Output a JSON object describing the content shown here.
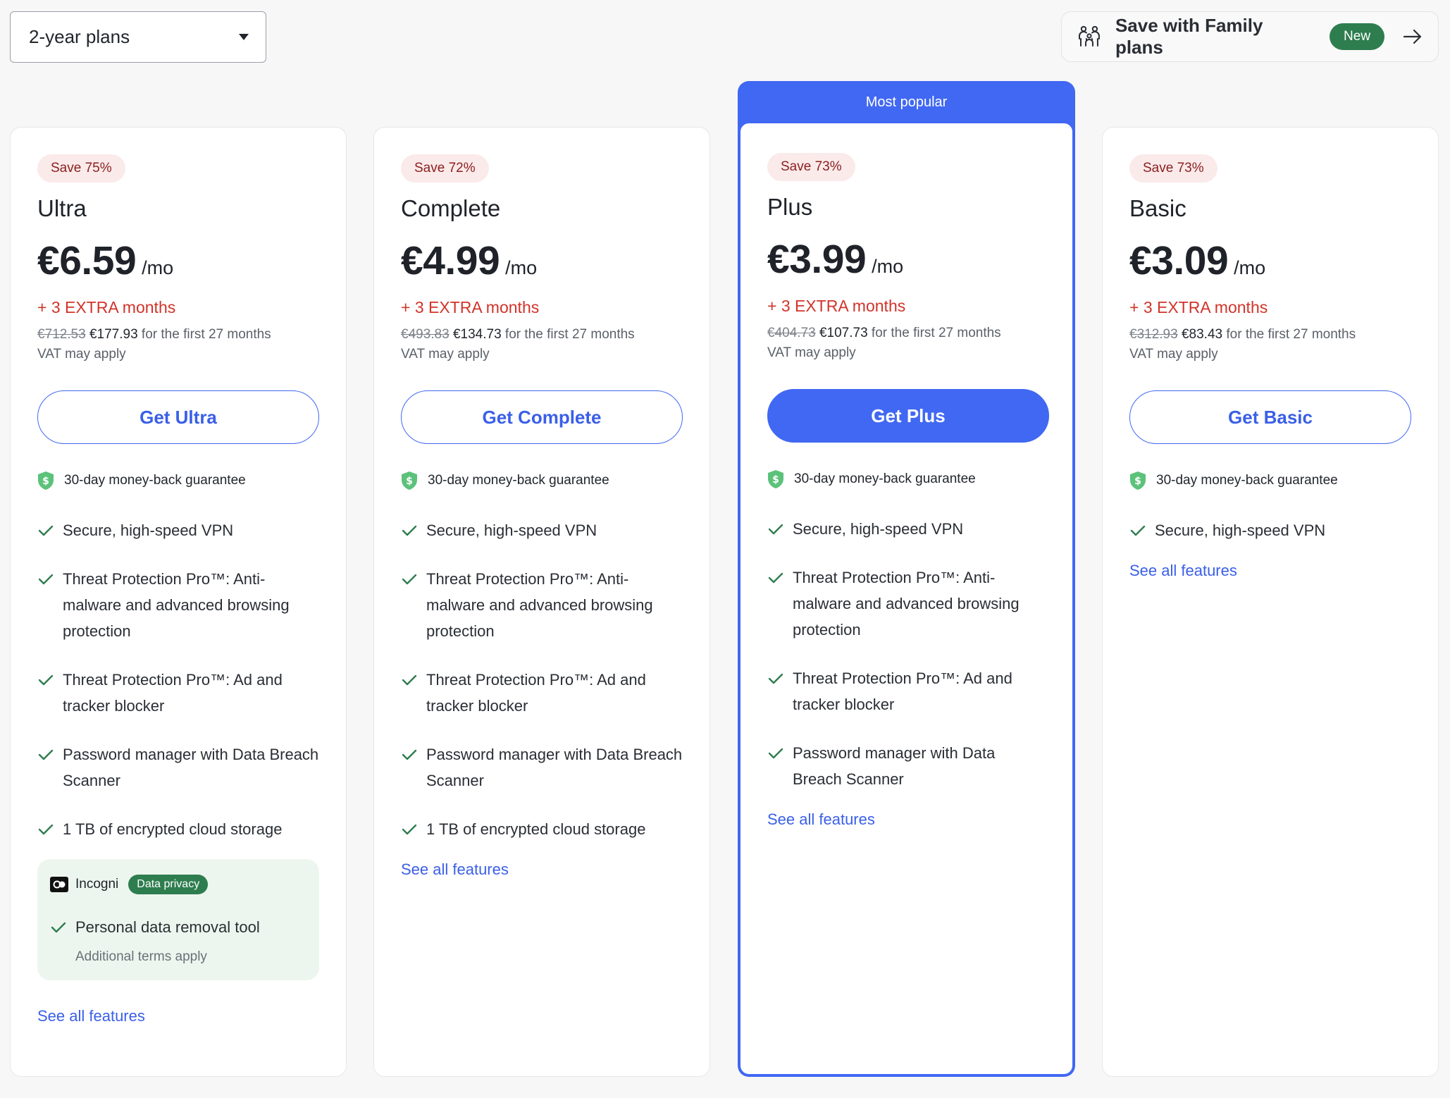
{
  "top_bar": {
    "plan_select_label": "2-year plans",
    "family_label": "Save with Family plans",
    "new_badge": "New"
  },
  "popular_label": "Most popular",
  "plans": [
    {
      "save": "Save 75%",
      "name": "Ultra",
      "price": "€6.59",
      "per": "/mo",
      "extra": "+ 3 EXTRA months",
      "old_price": "€712.53",
      "new_price": "€177.93",
      "period": " for the first 27 months",
      "vat": "VAT may apply",
      "cta": "Get Ultra",
      "guarantee": "30-day money-back guarantee",
      "features": [
        "Secure, high-speed VPN",
        "Threat Protection Pro™: Anti-malware and advanced browsing protection",
        "Threat Protection Pro™: Ad and tracker blocker",
        "Password manager with Data Breach Scanner",
        "1 TB of encrypted cloud storage"
      ],
      "incogni": {
        "name": "Incogni",
        "badge": "Data privacy",
        "feature": "Personal data removal tool",
        "terms": "Additional terms apply"
      },
      "see_all": "See all features"
    },
    {
      "save": "Save 72%",
      "name": "Complete",
      "price": "€4.99",
      "per": "/mo",
      "extra": "+ 3 EXTRA months",
      "old_price": "€493.83",
      "new_price": "€134.73",
      "period": " for the first 27 months",
      "vat": "VAT may apply",
      "cta": "Get Complete",
      "guarantee": "30-day money-back guarantee",
      "features": [
        "Secure, high-speed VPN",
        "Threat Protection Pro™: Anti-malware and advanced browsing protection",
        "Threat Protection Pro™: Ad and tracker blocker",
        "Password manager with Data Breach Scanner",
        "1 TB of encrypted cloud storage"
      ],
      "see_all": "See all features"
    },
    {
      "save": "Save 73%",
      "name": "Plus",
      "price": "€3.99",
      "per": "/mo",
      "extra": "+ 3 EXTRA months",
      "old_price": "€404.73",
      "new_price": "€107.73",
      "period": " for the first 27 months",
      "vat": "VAT may apply",
      "cta": "Get Plus",
      "guarantee": "30-day money-back guarantee",
      "features": [
        "Secure, high-speed VPN",
        "Threat Protection Pro™: Anti-malware and advanced browsing protection",
        "Threat Protection Pro™: Ad and tracker blocker",
        "Password manager with Data Breach Scanner"
      ],
      "see_all": "See all features"
    },
    {
      "save": "Save 73%",
      "name": "Basic",
      "price": "€3.09",
      "per": "/mo",
      "extra": "+ 3 EXTRA months",
      "old_price": "€312.93",
      "new_price": "€83.43",
      "period": " for the first 27 months",
      "vat": "VAT may apply",
      "cta": "Get Basic",
      "guarantee": "30-day money-back guarantee",
      "features": [
        "Secure, high-speed VPN"
      ],
      "see_all": "See all features"
    }
  ],
  "colors": {
    "accent": "#4168f2",
    "extra_red": "#d1342a",
    "check_green": "#2e7d4f",
    "shield_green": "#5cc27a"
  }
}
